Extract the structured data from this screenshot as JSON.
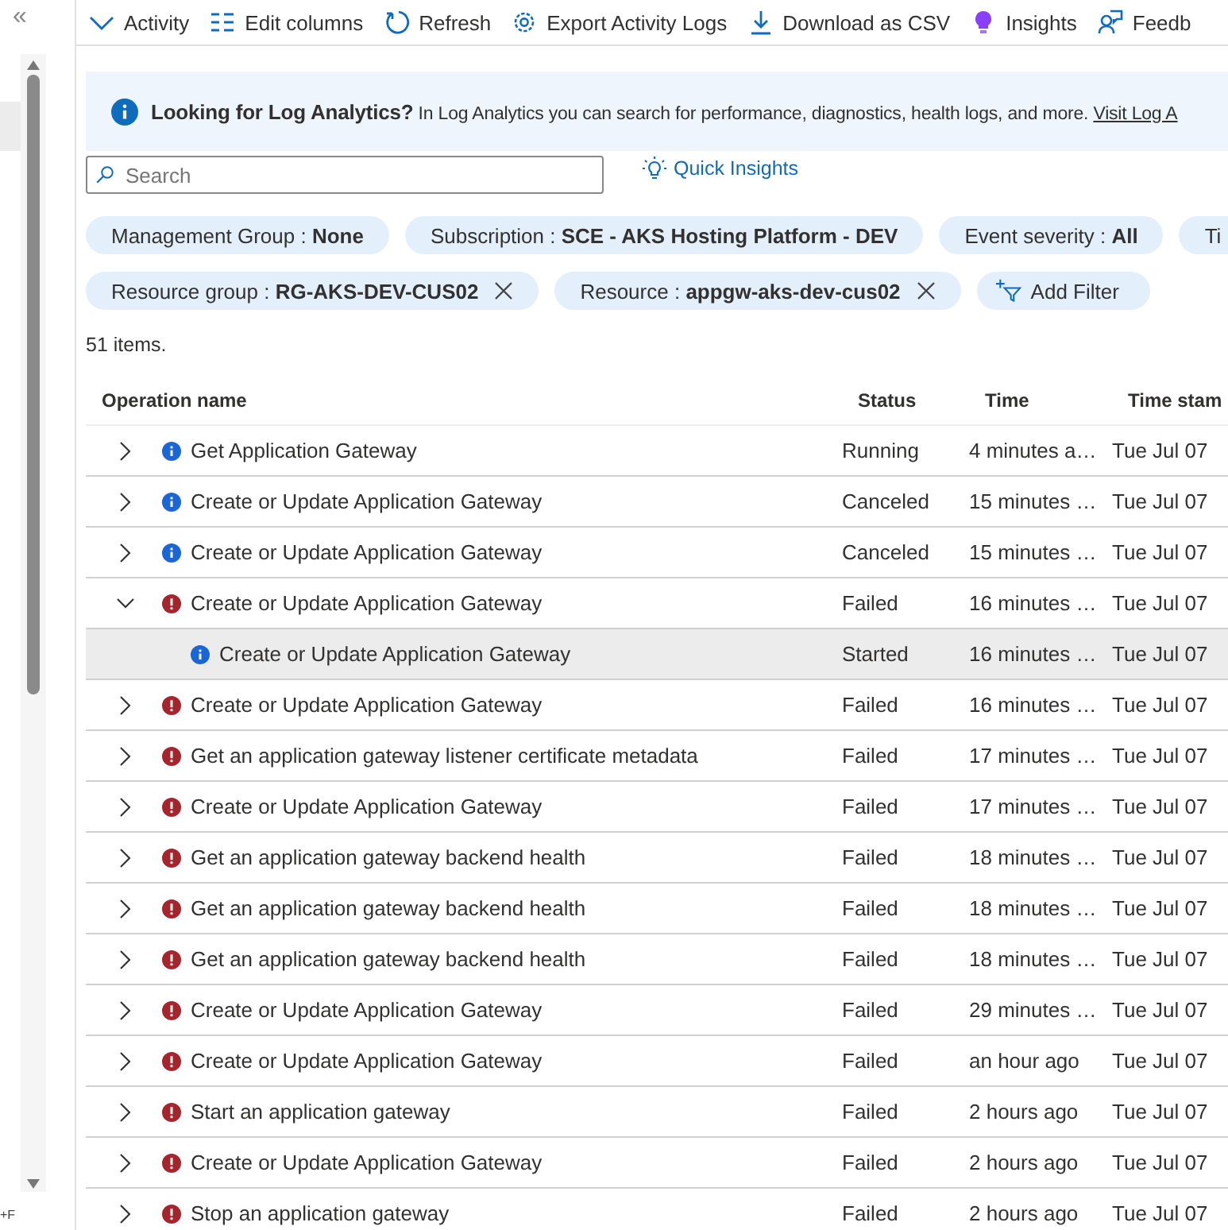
{
  "toolbar": [
    {
      "kind": "chevron",
      "label": "Activity"
    },
    {
      "kind": "columns",
      "label": "Edit columns"
    },
    {
      "kind": "refresh",
      "label": "Refresh"
    },
    {
      "kind": "gear",
      "label": "Export Activity Logs"
    },
    {
      "kind": "download",
      "label": "Download as CSV"
    },
    {
      "kind": "bulb",
      "label": "Insights"
    },
    {
      "kind": "feedback",
      "label": "Feedb"
    }
  ],
  "sidebar": {
    "collapse": "«",
    "footer": "+F"
  },
  "banner": {
    "title": "Looking for Log Analytics?",
    "text": "In Log Analytics you can search for performance, diagnostics, health logs, and more.",
    "link": "Visit Log A"
  },
  "search": {
    "placeholder": "Search"
  },
  "quick_insights": "Quick Insights",
  "filters": [
    {
      "name": "Management Group :",
      "value": "None",
      "removable": false
    },
    {
      "name": "Subscription :",
      "value": "SCE - AKS Hosting Platform - DEV",
      "removable": false
    },
    {
      "name": "Event severity :",
      "value": "All",
      "removable": false
    },
    {
      "name": "Ti",
      "removable": false
    },
    {
      "name": "Resource group :",
      "value": "RG-AKS-DEV-CUS02",
      "removable": true
    },
    {
      "name": "Resource :",
      "value": "appgw-aks-dev-cus02",
      "removable": true
    }
  ],
  "add_filter": "Add Filter",
  "count": "51 items.",
  "table": {
    "columns": [
      "Operation name",
      "Status",
      "Time",
      "Time stam"
    ],
    "rows": [
      {
        "kind": "info",
        "expanded": false,
        "selected": false,
        "name": "Get Application Gateway",
        "status": "Running",
        "time": "4 minutes a…",
        "stamp": "Tue Jul 07"
      },
      {
        "kind": "info",
        "expanded": false,
        "selected": false,
        "name": "Create or Update Application Gateway",
        "status": "Canceled",
        "time": "15 minutes …",
        "stamp": "Tue Jul 07"
      },
      {
        "kind": "info",
        "expanded": false,
        "selected": false,
        "name": "Create or Update Application Gateway",
        "status": "Canceled",
        "time": "15 minutes …",
        "stamp": "Tue Jul 07"
      },
      {
        "kind": "error",
        "expanded": true,
        "selected": false,
        "name": "Create or Update Application Gateway",
        "status": "Failed",
        "time": "16 minutes …",
        "stamp": "Tue Jul 07",
        "children": [
          {
            "kind": "info",
            "selected": true,
            "name": "Create or Update Application Gateway",
            "status": "Started",
            "time": "16 minutes …",
            "stamp": "Tue Jul 07"
          }
        ]
      },
      {
        "kind": "error",
        "expanded": false,
        "selected": false,
        "name": "Create or Update Application Gateway",
        "status": "Failed",
        "time": "16 minutes …",
        "stamp": "Tue Jul 07"
      },
      {
        "kind": "error",
        "expanded": false,
        "selected": false,
        "name": "Get an application gateway listener certificate metadata",
        "status": "Failed",
        "time": "17 minutes …",
        "stamp": "Tue Jul 07"
      },
      {
        "kind": "error",
        "expanded": false,
        "selected": false,
        "name": "Create or Update Application Gateway",
        "status": "Failed",
        "time": "17 minutes …",
        "stamp": "Tue Jul 07"
      },
      {
        "kind": "error",
        "expanded": false,
        "selected": false,
        "name": "Get an application gateway backend health",
        "status": "Failed",
        "time": "18 minutes …",
        "stamp": "Tue Jul 07"
      },
      {
        "kind": "error",
        "expanded": false,
        "selected": false,
        "name": "Get an application gateway backend health",
        "status": "Failed",
        "time": "18 minutes …",
        "stamp": "Tue Jul 07"
      },
      {
        "kind": "error",
        "expanded": false,
        "selected": false,
        "name": "Get an application gateway backend health",
        "status": "Failed",
        "time": "18 minutes …",
        "stamp": "Tue Jul 07"
      },
      {
        "kind": "error",
        "expanded": false,
        "selected": false,
        "name": "Create or Update Application Gateway",
        "status": "Failed",
        "time": "29 minutes …",
        "stamp": "Tue Jul 07"
      },
      {
        "kind": "error",
        "expanded": false,
        "selected": false,
        "name": "Create or Update Application Gateway",
        "status": "Failed",
        "time": "an hour ago",
        "stamp": "Tue Jul 07"
      },
      {
        "kind": "error",
        "expanded": false,
        "selected": false,
        "name": "Start an application gateway",
        "status": "Failed",
        "time": "2 hours ago",
        "stamp": "Tue Jul 07"
      },
      {
        "kind": "error",
        "expanded": false,
        "selected": false,
        "name": "Create or Update Application Gateway",
        "status": "Failed",
        "time": "2 hours ago",
        "stamp": "Tue Jul 07"
      },
      {
        "kind": "error",
        "expanded": false,
        "selected": false,
        "name": "Stop an application gateway",
        "status": "Failed",
        "time": "2 hours ago",
        "stamp": "Tue Jul 07"
      }
    ]
  }
}
